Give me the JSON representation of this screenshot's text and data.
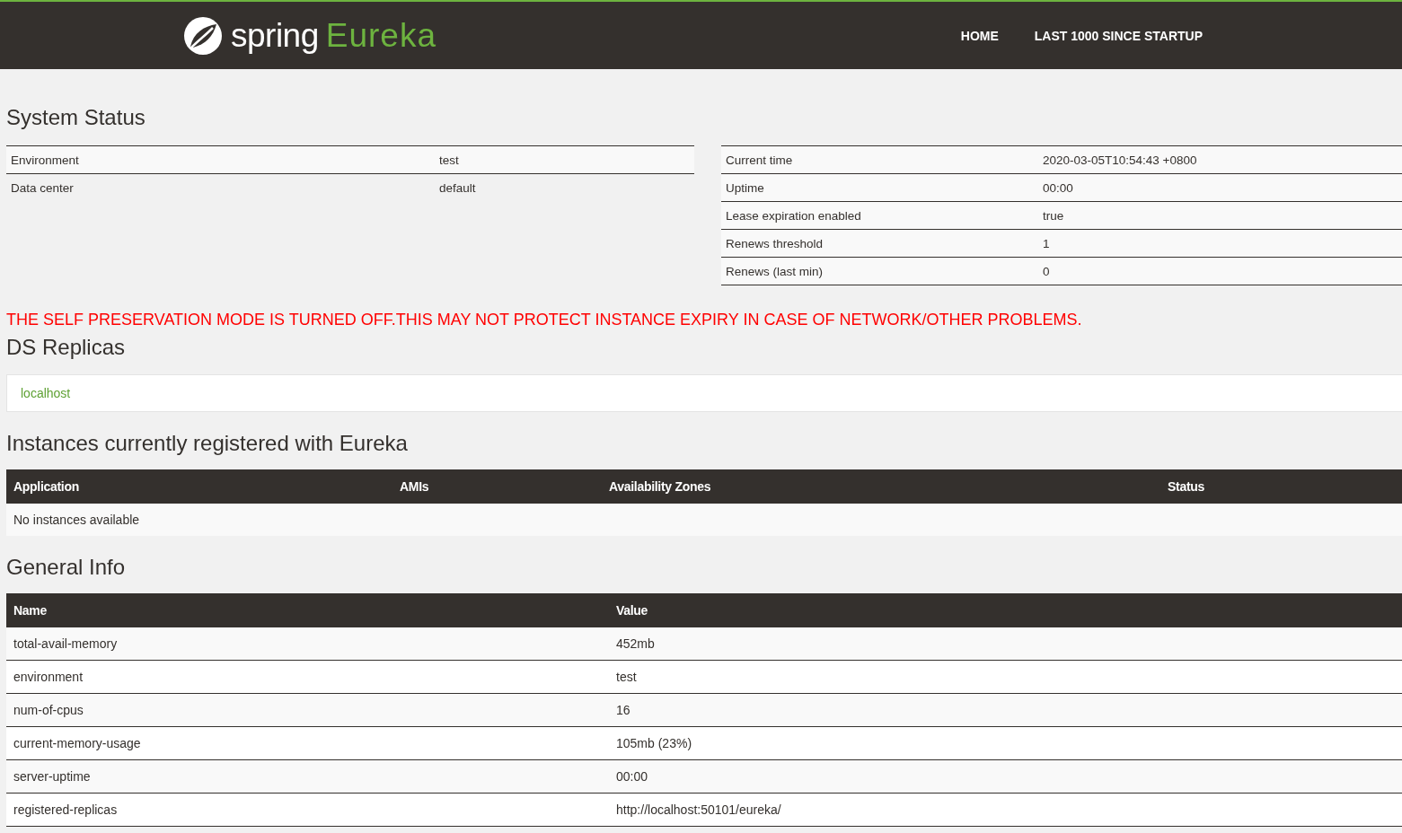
{
  "header": {
    "logo": {
      "brand": "spring",
      "product": "Eureka"
    },
    "nav": [
      "HOME",
      "LAST 1000 SINCE STARTUP"
    ]
  },
  "system_status": {
    "title": "System Status",
    "left_table": [
      {
        "label": "Environment",
        "value": "test"
      },
      {
        "label": "Data center",
        "value": "default"
      }
    ],
    "right_table": [
      {
        "label": "Current time",
        "value": "2020-03-05T10:54:43 +0800"
      },
      {
        "label": "Uptime",
        "value": "00:00"
      },
      {
        "label": "Lease expiration enabled",
        "value": "true"
      },
      {
        "label": "Renews threshold",
        "value": "1"
      },
      {
        "label": "Renews (last min)",
        "value": "0"
      }
    ]
  },
  "warning": "THE SELF PRESERVATION MODE IS TURNED OFF.THIS MAY NOT PROTECT INSTANCE EXPIRY IN CASE OF NETWORK/OTHER PROBLEMS.",
  "ds_replicas": {
    "title": "DS Replicas",
    "items": [
      "localhost"
    ]
  },
  "instances": {
    "title": "Instances currently registered with Eureka",
    "columns": [
      "Application",
      "AMIs",
      "Availability Zones",
      "Status"
    ],
    "empty_message": "No instances available"
  },
  "general_info": {
    "title": "General Info",
    "columns": [
      "Name",
      "Value"
    ],
    "rows": [
      {
        "name": "total-avail-memory",
        "value": "452mb"
      },
      {
        "name": "environment",
        "value": "test"
      },
      {
        "name": "num-of-cpus",
        "value": "16"
      },
      {
        "name": "current-memory-usage",
        "value": "105mb (23%)"
      },
      {
        "name": "server-uptime",
        "value": "00:00"
      },
      {
        "name": "registered-replicas",
        "value": "http://localhost:50101/eureka/"
      }
    ]
  }
}
